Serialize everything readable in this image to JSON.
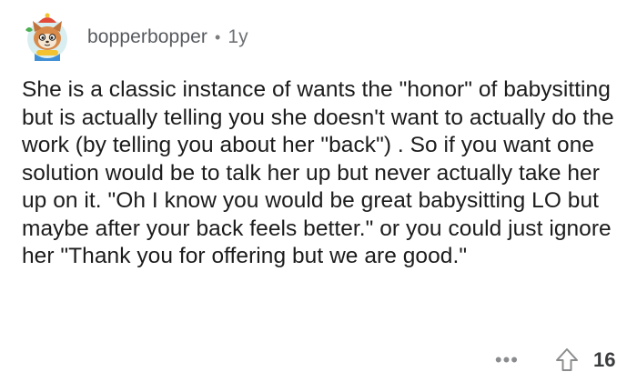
{
  "comment": {
    "username": "bopperbopper",
    "separator": "•",
    "age": "1y",
    "avatar_icon": "cartoon-character-avatar-icon",
    "body": "She is a classic instance of wants the \"honor\" of babysitting but is actually telling you she doesn't want to actually do the work (by telling you about her \"back\") .  So if you want one solution would be to talk her up but never actually take her up on it. \"Oh I know you would be  great babysitting LO but maybe after your back feels better.\"  or you could just ignore her \"Thank you for offering but we are good.\"",
    "more_label": "•••",
    "upvote_icon": "upvote-arrow-icon",
    "vote_count": "16"
  },
  "colors": {
    "avatar_bg": "#7fc8c4",
    "avatar_accent": "#e24a3a",
    "meta_text": "#575a5e",
    "body_text": "#1c1c1c",
    "icon_gray": "#8a8c8e"
  }
}
